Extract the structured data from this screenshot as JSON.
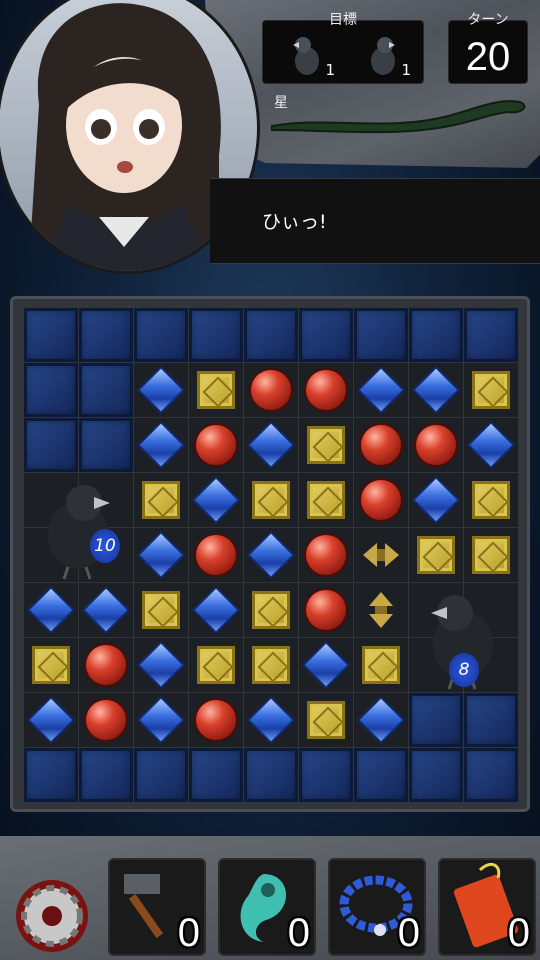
{
  "hud": {
    "goal_label": "目標",
    "turn_label": "ターン",
    "turns": "20",
    "star_label": "星",
    "goals": [
      {
        "icon": "crow-icon",
        "count": "1"
      },
      {
        "icon": "crow-icon",
        "count": "1"
      }
    ]
  },
  "dialogue": {
    "text": "ひぃっ!"
  },
  "board": {
    "cols": 9,
    "rows": 9,
    "grid": [
      [
        "b",
        "b",
        "b",
        "b",
        "b",
        "b",
        "b",
        "b",
        "b"
      ],
      [
        "b",
        "b",
        "g",
        "y",
        "r",
        "r",
        "g",
        "g",
        "y"
      ],
      [
        "b",
        "b",
        "g",
        "r",
        "g",
        "y",
        "r",
        "r",
        "g"
      ],
      [
        "c",
        "c",
        "y",
        "g",
        "y",
        "y",
        "r",
        "g",
        "y"
      ],
      [
        "c",
        "c",
        "g",
        "r",
        "g",
        "r",
        "h",
        "y",
        "y"
      ],
      [
        "g",
        "g",
        "y",
        "g",
        "y",
        "r",
        "v",
        "c",
        "c"
      ],
      [
        "y",
        "r",
        "g",
        "y",
        "y",
        "g",
        "y",
        "c",
        "c"
      ],
      [
        "g",
        "r",
        "g",
        "r",
        "g",
        "y",
        "g",
        "b",
        "b"
      ],
      [
        "b",
        "b",
        "b",
        "b",
        "b",
        "b",
        "b",
        "b",
        "b"
      ]
    ],
    "crows": [
      {
        "hp": "10"
      },
      {
        "hp": "8"
      }
    ]
  },
  "items": [
    {
      "name": "hammer",
      "icon": "hammer-icon",
      "count": "0"
    },
    {
      "name": "magatama",
      "icon": "magatama-icon",
      "count": "0"
    },
    {
      "name": "prayer-beads",
      "icon": "beads-icon",
      "count": "0"
    },
    {
      "name": "omamori",
      "icon": "omamori-icon",
      "count": "0"
    }
  ]
}
